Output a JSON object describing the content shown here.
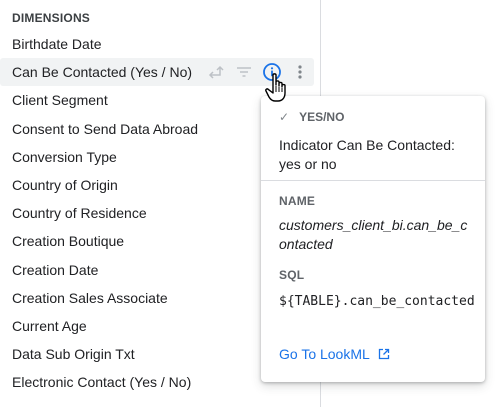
{
  "dimensions": {
    "heading": "DIMENSIONS",
    "fields": [
      "Birthdate Date",
      "Can Be Contacted (Yes / No)",
      "Client Segment",
      "Consent to Send Data Abroad",
      "Conversion Type",
      "Country of Origin",
      "Country of Residence",
      "Creation Boutique",
      "Creation Date",
      "Creation Sales Associate",
      "Current Age",
      "Data Sub Origin Txt",
      "Electronic Contact (Yes / No)"
    ],
    "active_index": 1
  },
  "popup": {
    "type_label": "YES/NO",
    "check_glyph": "✓",
    "description": "Indicator Can Be Contacted: yes or no",
    "name_label": "NAME",
    "name_value": "customers_client_bi.can_be_contacted",
    "sql_label": "SQL",
    "sql_value": "${TABLE}.can_be_contacted",
    "link_label": "Go To LookML"
  },
  "colors": {
    "accent": "#1a73e8",
    "icon_gray": "#9aa0a6",
    "active_row_bg": "#f1f3f4"
  }
}
